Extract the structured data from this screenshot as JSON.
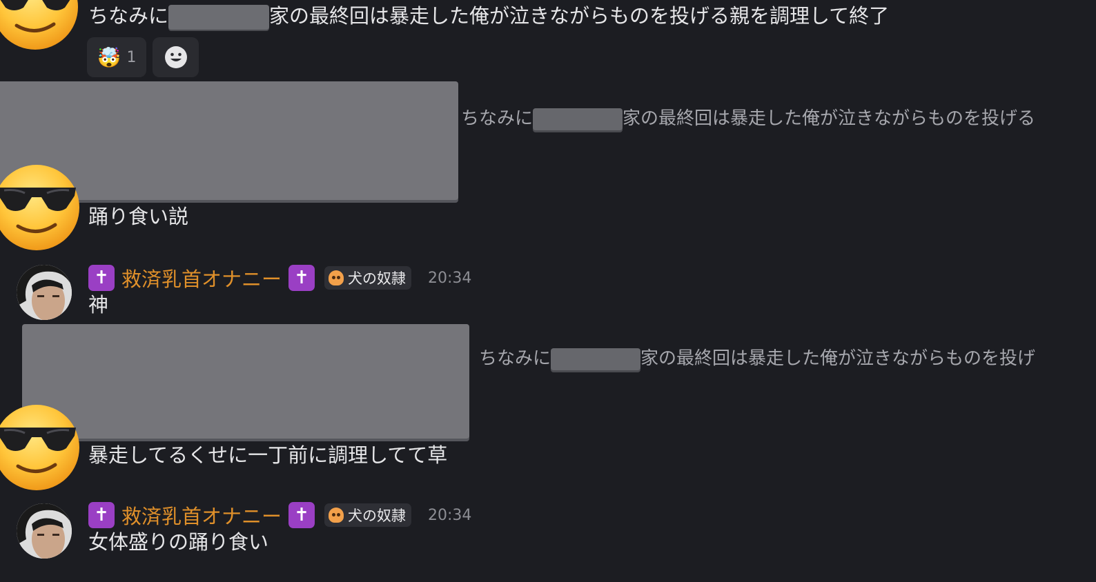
{
  "messages": {
    "m1": {
      "text_prefix": "ちなみに",
      "text_suffix": "家の最終回は暴走した俺が泣きながらものを投げる親を調理して終了",
      "reaction": {
        "emoji": "🤯",
        "count": "1"
      },
      "add_reaction_icon": "smiley-add-icon"
    },
    "m2": {
      "reply_prefix": "ちなみに",
      "reply_suffix": "家の最終回は暴走した俺が泣きながらものを投げる",
      "text": "踊り食い説"
    },
    "m3": {
      "username": "救済乳首オナニー",
      "badge": "犬の奴隷",
      "time": "20:34",
      "text": "神"
    },
    "m4": {
      "reply_prefix": "ちなみに",
      "reply_suffix": "家の最終回は暴走した俺が泣きながらものを投げ",
      "text": "暴走してるくせに一丁前に調理してて草"
    },
    "m5": {
      "username": "救済乳首オナニー",
      "badge": "犬の奴隷",
      "time": "20:34",
      "text": "女体盛りの踊り食い"
    }
  },
  "icons": {
    "cross": "✝",
    "sunglasses_face": "smiling-face-with-sunglasses-icon",
    "skull": "skull-icon"
  },
  "colors": {
    "background": "#1c1d22",
    "username": "#e0902a",
    "cross_badge": "#9a3fc4",
    "timestamp": "#8d8e94"
  }
}
